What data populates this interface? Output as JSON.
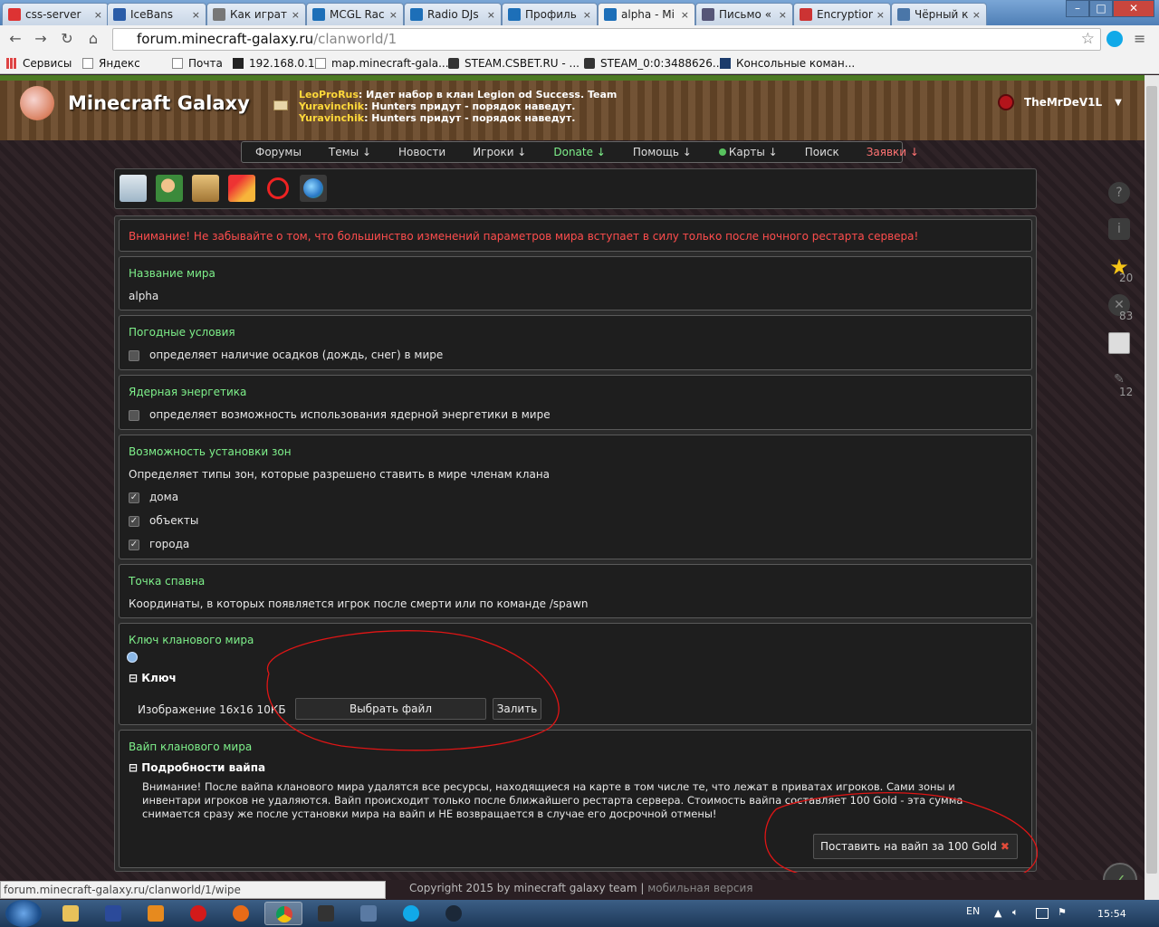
{
  "browser": {
    "tabs": [
      {
        "label": "css-server",
        "color": "#d33"
      },
      {
        "label": "IceBans",
        "color": "#2a5ca8"
      },
      {
        "label": "Как играт",
        "color": "#777"
      },
      {
        "label": "MCGL Rac",
        "color": "#1d6fb8"
      },
      {
        "label": "Radio DJs",
        "color": "#1d6fb8"
      },
      {
        "label": "Профиль",
        "color": "#1d6fb8"
      },
      {
        "label": "alpha - Mi",
        "color": "#1d6fb8"
      },
      {
        "label": "Письмо «",
        "color": "#557"
      },
      {
        "label": "Encryption",
        "color": "#c33"
      },
      {
        "label": "Чёрный к",
        "color": "#4a76a8"
      }
    ],
    "tab_close": "×",
    "window_buttons": [
      "–",
      "□",
      "✕"
    ],
    "url_host": "forum.minecraft-galaxy.ru",
    "url_path": "/clanworld/1",
    "bookmarks": [
      "Сервисы",
      "Яндекс",
      "Почта",
      "192.168.0.1",
      "map.minecraft-gala...",
      "STEAM.CSBET.RU - ...",
      "STEAM_0:0:3488626...",
      "Консольные коман..."
    ],
    "status_url": "forum.minecraft-galaxy.ru/clanworld/1/wipe"
  },
  "site": {
    "name": "Minecraft Galaxy",
    "ticker": [
      {
        "nick": "LeoProRus",
        "msg": ": Идет набор в клан Legion od Success. Team"
      },
      {
        "nick": "Yuravinchik",
        "msg": ": Hunters придут - порядок наведут."
      },
      {
        "nick": "Yuravinchik",
        "msg": ": Hunters придут - порядок наведут."
      }
    ],
    "username": "TheMrDeV1L",
    "menu": [
      "Форумы",
      "Темы ↓",
      "Новости",
      "Игроки ↓",
      "Donate ↓",
      "Помощь ↓",
      "Карты ↓",
      "Поиск",
      "Заявки ↓"
    ],
    "sidebar_counts": [
      "20",
      "83",
      "12"
    ],
    "copyright": "Copyright 2015 by minecraft galaxy team",
    "footer_sep": " | ",
    "mobile": "мобильная версия"
  },
  "world": {
    "warning": "Внимание! Не забывайте о том, что большинство изменений параметров мира вступает в силу только после ночного рестарта сервера!",
    "name_title": "Название мира",
    "name_value": "alpha",
    "weather_title": "Погодные условия",
    "weather_desc": "определяет наличие осадков (дождь, снег) в мире",
    "nuclear_title": "Ядерная энергетика",
    "nuclear_desc": "определяет возможность использования ядерной энергетики в мире",
    "zones_title": "Возможность установки зон",
    "zones_desc": "Определяет типы зон, которые разрешено ставить в мире членам клана",
    "zones": [
      "дома",
      "объекты",
      "города"
    ],
    "spawn_title": "Точка спавна",
    "spawn_desc": "Координаты, в которых появляется игрок после смерти или по команде /spawn",
    "key_title": "Ключ кланового мира",
    "key_section": "Ключ",
    "key_image_label": "Изображение 16x16 10КБ",
    "choose_file": "Выбрать файл",
    "upload": "Залить",
    "wipe_title": "Вайп кланового мира",
    "wipe_section": "Подробности вайпа",
    "wipe_text_1": "Внимание! После вайпа кланового мира удалятся все ресурсы, находящиеся на карте в том числе те, что лежат в приватах игроков. Сами зоны и",
    "wipe_text_2": "инвентари игроков не удаляются. Вайп происходит только после ближайшего рестарта сервера. Стоимость вайпа составляет 100 Gold - эта сумма",
    "wipe_text_3": "снимается сразу же после установки мира на вайп и НЕ возвращается в случае его досрочной отмены!",
    "wipe_button": "Поставить на вайп за 100 Gold"
  },
  "taskbar": {
    "lang": "EN",
    "time": "15:54"
  }
}
